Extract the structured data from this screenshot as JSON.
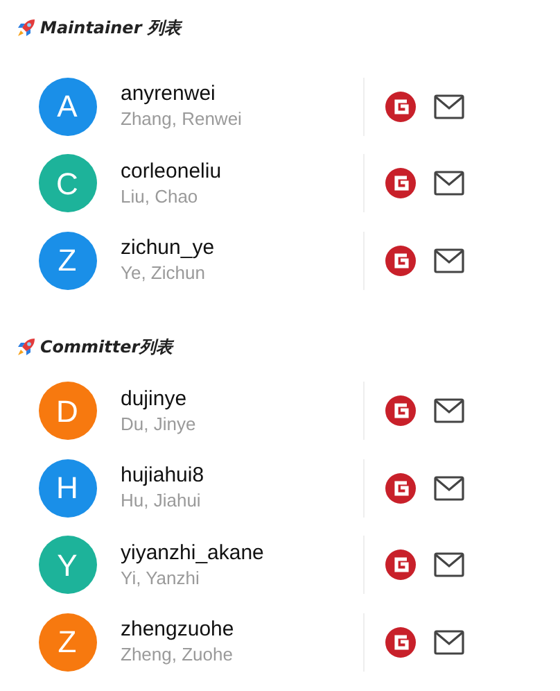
{
  "sections": [
    {
      "title": "Maintainer 列表",
      "members": [
        {
          "initial": "A",
          "color": "#1a8fe8",
          "login": "anyrenwei",
          "name": "Zhang, Renwei"
        },
        {
          "initial": "C",
          "color": "#1db39a",
          "login": "corleoneliu",
          "name": "Liu, Chao"
        },
        {
          "initial": "Z",
          "color": "#1a8fe8",
          "login": "zichun_ye",
          "name": "Ye, Zichun"
        }
      ]
    },
    {
      "title": "Committer列表",
      "members": [
        {
          "initial": "D",
          "color": "#f7790f",
          "login": "dujinye",
          "name": "Du, Jinye"
        },
        {
          "initial": "H",
          "color": "#1a8fe8",
          "login": "hujiahui8",
          "name": "Hu, Jiahui"
        },
        {
          "initial": "Y",
          "color": "#1db39a",
          "login": "yiyanzhi_akane",
          "name": "Yi, Yanzhi"
        },
        {
          "initial": "Z",
          "color": "#f7790f",
          "login": "zhengzuohe",
          "name": "Zheng, Zuohe"
        }
      ]
    }
  ]
}
